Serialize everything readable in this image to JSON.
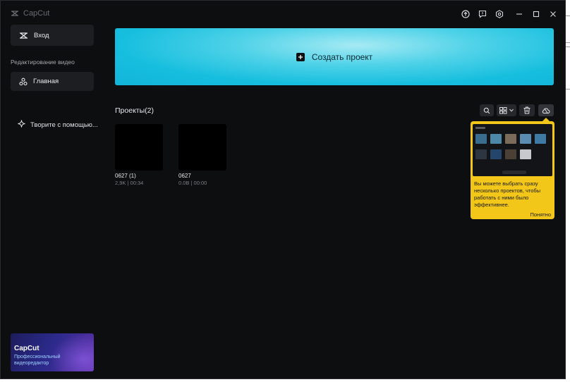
{
  "app": {
    "title": "CapCut"
  },
  "titlebar": {
    "buttons": [
      {
        "icon": "upload-icon"
      },
      {
        "icon": "feedback-icon"
      },
      {
        "icon": "settings-icon"
      },
      {
        "icon": "minimize-icon"
      },
      {
        "icon": "maximize-icon"
      },
      {
        "icon": "close-icon"
      }
    ]
  },
  "sidebar": {
    "login_label": "Вход",
    "section_title": "Редактирование видео",
    "home_label": "Главная",
    "ai_label": "Творите с помощью...",
    "promo": {
      "brand": "CapCut",
      "subtitle": "Профессиональный видеоредактор"
    }
  },
  "main": {
    "create_label": "Создать проект",
    "projects_title": "Проекты",
    "projects_count": "(2)",
    "projects": [
      {
        "name": "0627 (1)",
        "meta": "2,9K | 00:34"
      },
      {
        "name": "0627",
        "meta": "0.0B | 00:00"
      }
    ]
  },
  "tooltip": {
    "message": "Вы можете выбрать сразу несколько проектов, чтобы работать с ними было эффективнее.",
    "ok_label": "Понятно"
  },
  "colors": {
    "background": "#0d0e10",
    "accent_banner": "#16bede",
    "tooltip": "#f2c71a"
  }
}
